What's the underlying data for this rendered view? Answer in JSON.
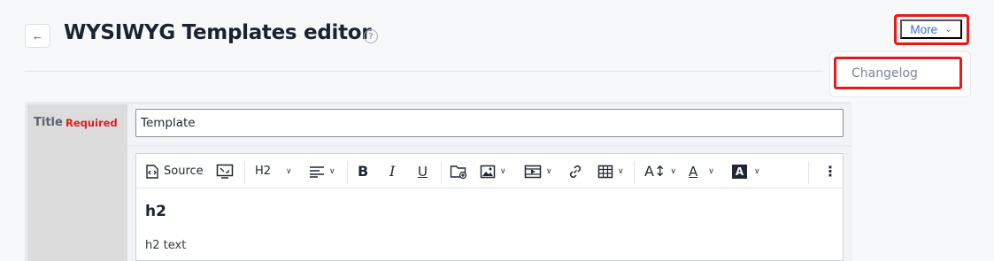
{
  "header": {
    "title": "WYSIWYG Templates editor",
    "help_icon": "help-circle-icon",
    "back_icon": "arrow-left-icon"
  },
  "more_menu": {
    "label": "More",
    "items": [
      "Changelog"
    ]
  },
  "form": {
    "title_label": "Title",
    "required_label": "Required",
    "title_value": "Template"
  },
  "toolbar": {
    "source_label": "Source",
    "heading_select": "H2",
    "icons": [
      "source-icon",
      "fullscreen-icon",
      "heading-select",
      "align-icon",
      "bold-icon",
      "italic-icon",
      "underline-icon",
      "file-browser-icon",
      "image-icon",
      "video-icon",
      "link-icon",
      "table-icon",
      "font-size-icon",
      "font-color-icon",
      "background-color-icon",
      "more-vertical-icon"
    ]
  },
  "content": {
    "heading": "h2",
    "paragraph": "h2 text"
  },
  "colors": {
    "accent": "#3a6fcf",
    "highlight": "#e21b1b",
    "required": "#e21b1b"
  }
}
